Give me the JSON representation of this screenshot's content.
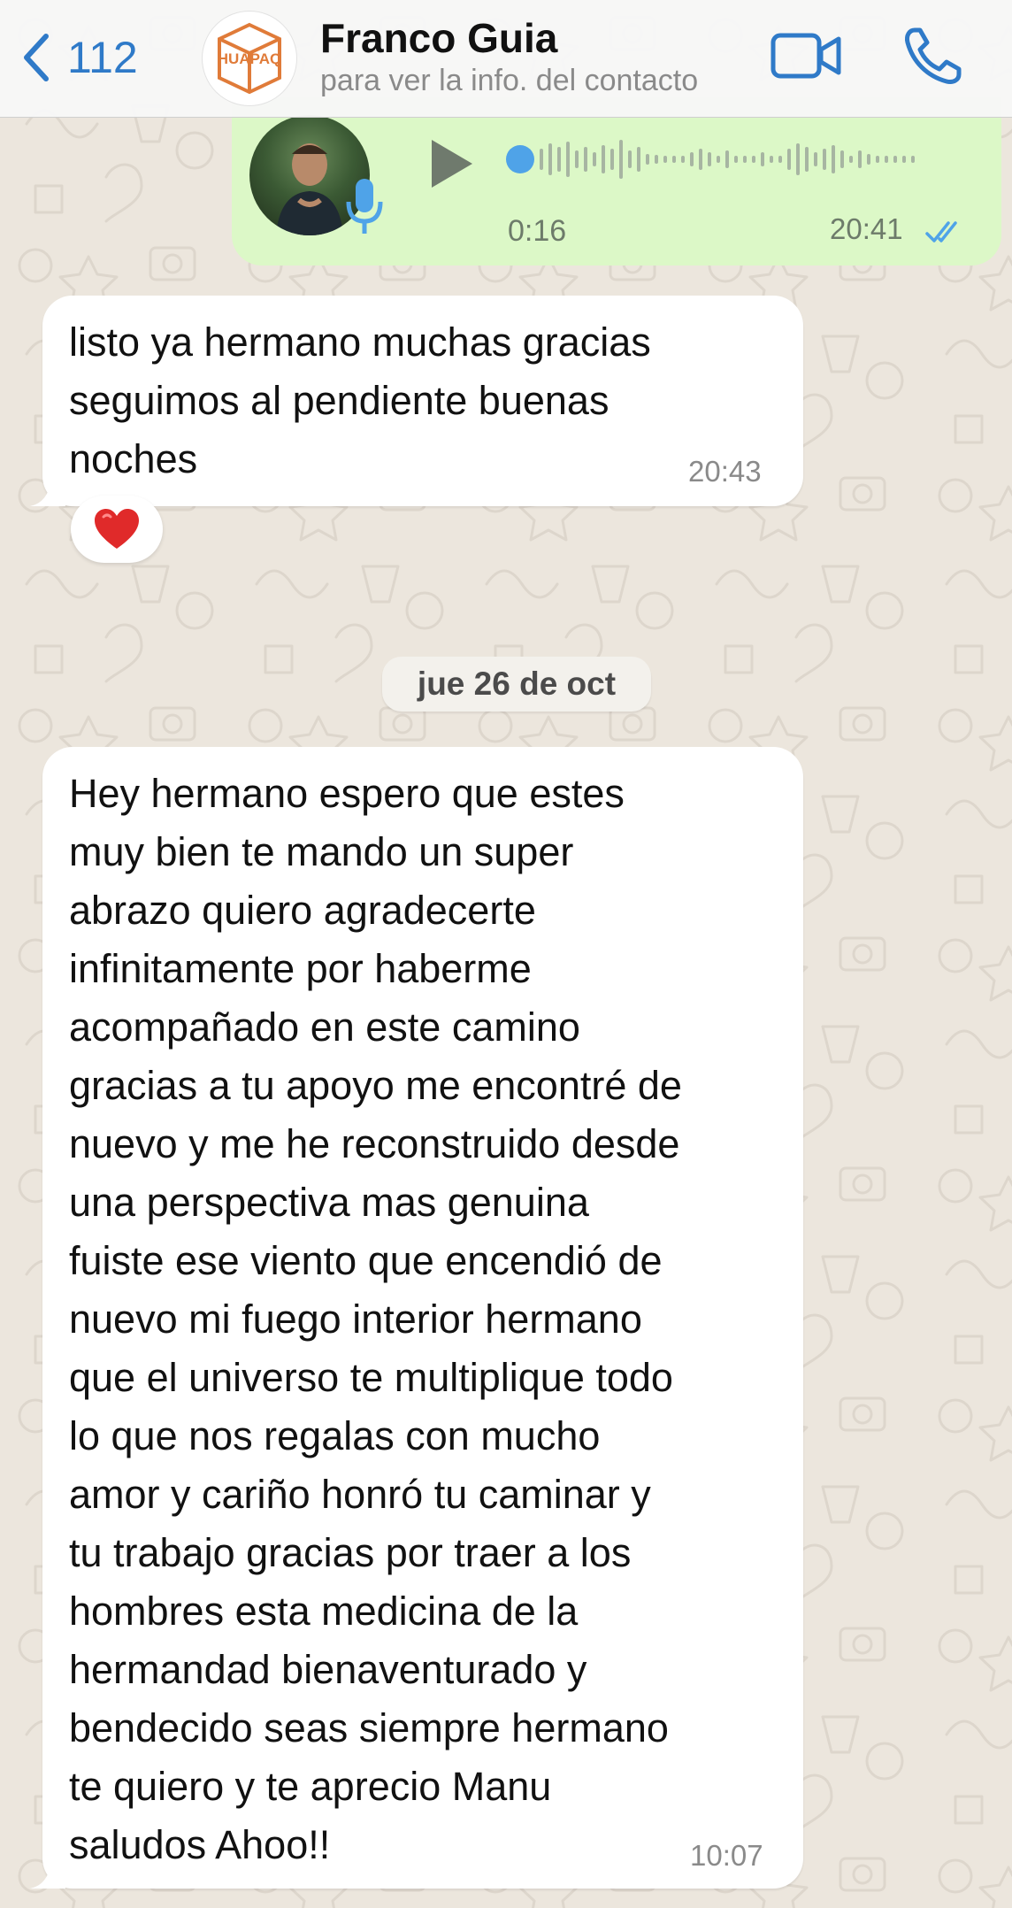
{
  "header": {
    "back_count": "112",
    "avatar_logo_text": "HUAPAQ",
    "contact_name": "Franco Guia",
    "contact_subtitle": "para ver la info. del contacto"
  },
  "voice_message": {
    "duration": "0:16",
    "time": "20:41",
    "status": "read"
  },
  "messages": [
    {
      "text": "listo ya hermano muchas gracias\nseguimos al pendiente buenas\nnoches",
      "time": "20:43",
      "reaction": "❤️"
    },
    {
      "text": "Hey hermano espero que estes\nmuy bien te mando un super\nabrazo quiero agradecerte\ninfinitamente por haberme\nacompañado en este camino\ngracias a tu apoyo me encontré de\nnuevo y me he reconstruido desde\nuna perspectiva mas genuina\nfuiste ese viento que encendió de\nnuevo mi fuego interior hermano\nque el universo te multiplique todo\nlo que nos regalas con mucho\namor y cariño honró tu caminar y\ntu trabajo gracias por traer a los\nhombres esta medicina de la\nhermandad bienaventurado y\nbendecido seas siempre hermano\nte quiero y te aprecio Manu\nsaludos Ahoo!!",
      "time": "10:07"
    }
  ],
  "date_separator": "jue 26 de oct",
  "colors": {
    "accent": "#2f7ac8",
    "outgoing_bubble": "#dcf8c7",
    "incoming_bubble": "#ffffff",
    "wallpaper": "#ece6dd",
    "read_tick": "#4fa3e8",
    "voice_progress": "#4fa3e8"
  },
  "icons": {
    "back": "chevron-left-icon",
    "video": "video-camera-icon",
    "call": "phone-icon",
    "play": "play-icon",
    "mic": "microphone-icon",
    "ticks": "double-check-icon"
  }
}
